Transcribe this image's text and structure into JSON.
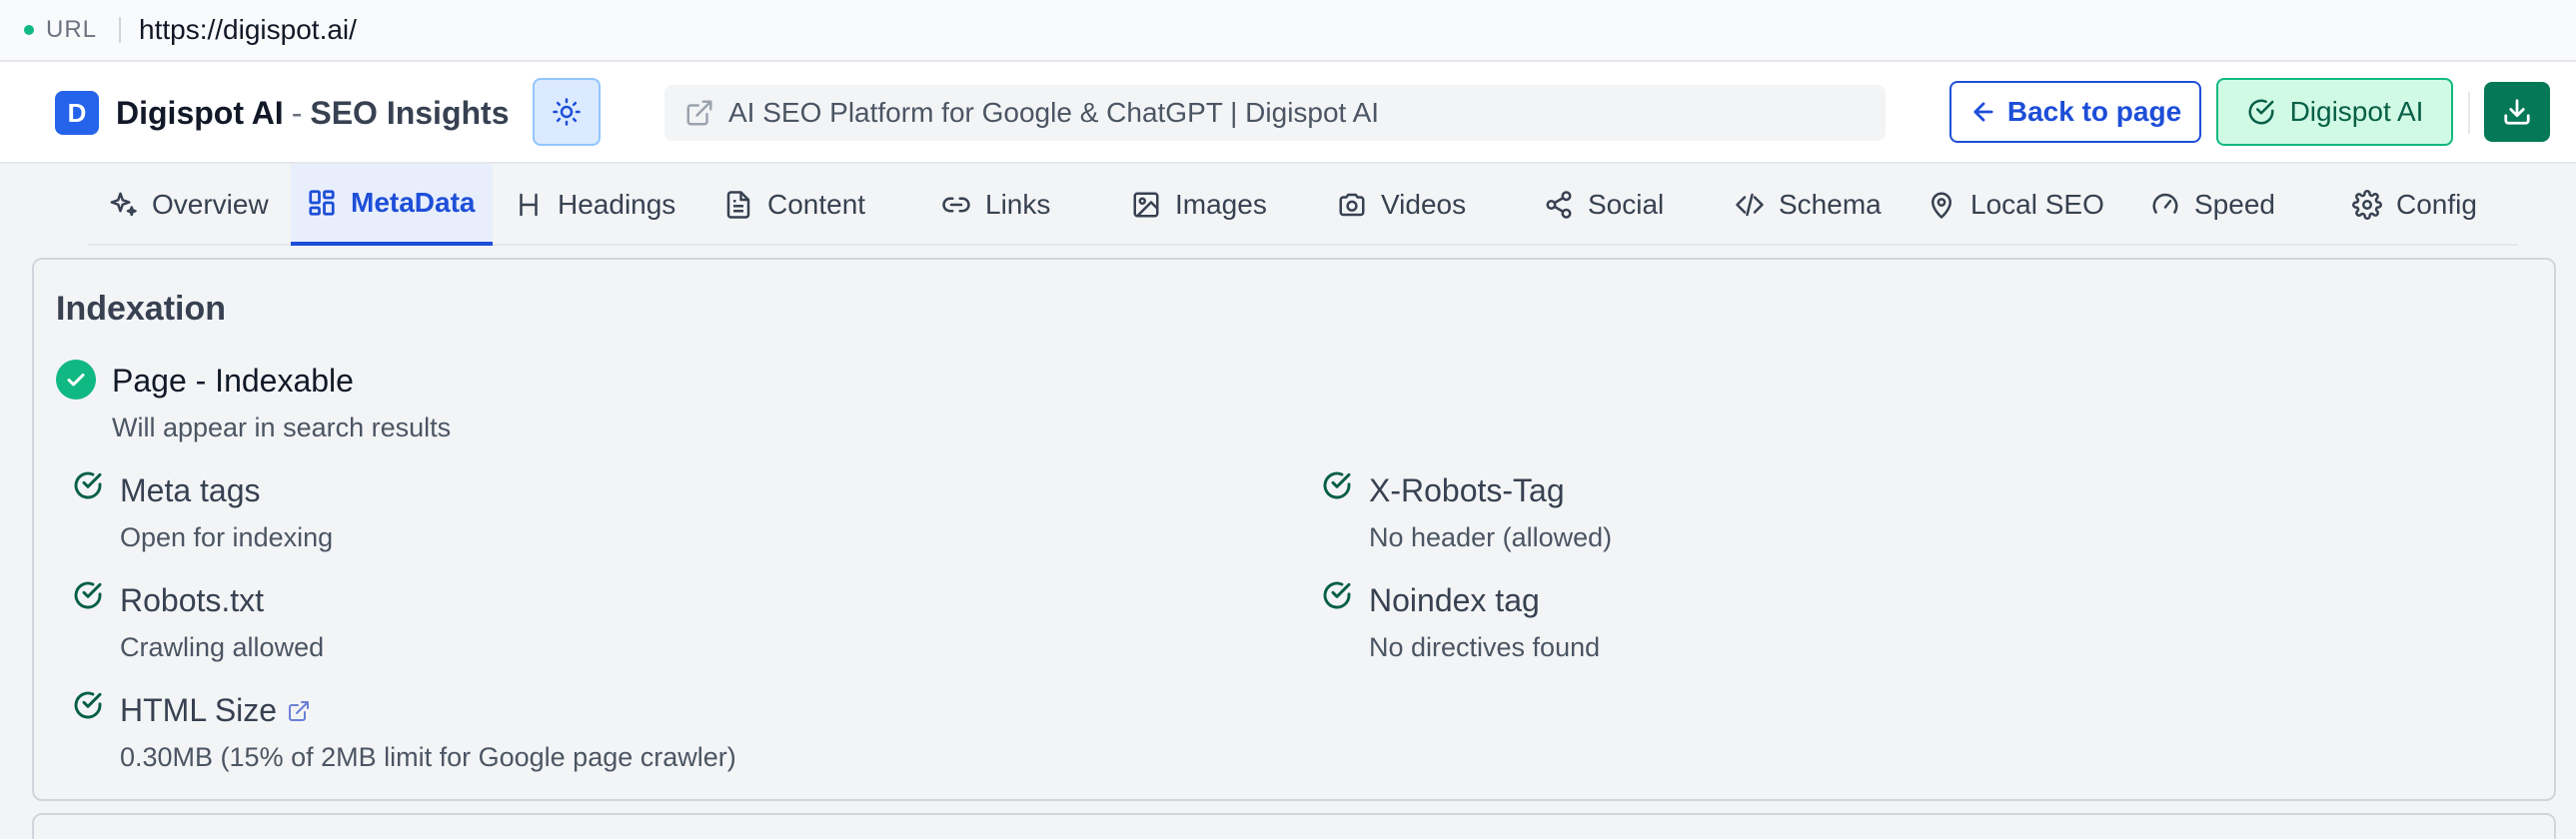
{
  "urlbar": {
    "label": "URL",
    "value": "https://digispot.ai/"
  },
  "header": {
    "logo_letter": "D",
    "brand_name": "Digispot AI",
    "brand_dash": "-",
    "brand_sub": "SEO Insights",
    "page_title": "AI SEO Platform for Google & ChatGPT | Digispot AI",
    "back_label": "Back to page",
    "ai_label": "Digispot AI"
  },
  "tabs": [
    {
      "label": "Overview",
      "icon": "sparkles-icon"
    },
    {
      "label": "MetaData",
      "icon": "grid-icon",
      "active": true
    },
    {
      "label": "Headings",
      "icon": "heading-icon"
    },
    {
      "label": "Content",
      "icon": "document-icon"
    },
    {
      "label": "Links",
      "icon": "link-icon"
    },
    {
      "label": "Images",
      "icon": "image-icon"
    },
    {
      "label": "Videos",
      "icon": "camera-icon"
    },
    {
      "label": "Social",
      "icon": "share-icon"
    },
    {
      "label": "Schema",
      "icon": "code-icon"
    },
    {
      "label": "Local SEO",
      "icon": "map-pin-icon"
    },
    {
      "label": "Speed",
      "icon": "gauge-icon"
    },
    {
      "label": "Config",
      "icon": "gear-icon"
    }
  ],
  "indexation": {
    "title": "Indexation",
    "status_title": "Page - Indexable",
    "status_sub": "Will appear in search results",
    "checks": [
      {
        "title": "Meta tags",
        "sub": "Open for indexing"
      },
      {
        "title": "X-Robots-Tag",
        "sub": "No header (allowed)"
      },
      {
        "title": "Robots.txt",
        "sub": "Crawling allowed"
      },
      {
        "title": "Noindex tag",
        "sub": "No directives found"
      },
      {
        "title": "HTML Size",
        "sub": "0.30MB (15% of 2MB limit for Google page crawler)"
      }
    ]
  },
  "colors": {
    "accent": "#1d4ed8",
    "success": "#10b981",
    "success_dark": "#047857"
  }
}
